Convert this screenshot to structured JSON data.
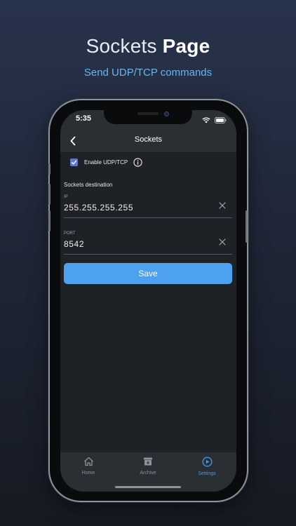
{
  "headline": {
    "regular": "Sockets ",
    "bold": "Page"
  },
  "subline": "Send UDP/TCP commands",
  "status_bar": {
    "time": "5:35"
  },
  "nav": {
    "title": "Sockets"
  },
  "settings": {
    "enable_label": "Enable UDP/TCP",
    "enabled": true,
    "section_title": "Sockets destination",
    "ip": {
      "label": "IP",
      "value": "255.255.255.255"
    },
    "port": {
      "label": "PORT",
      "value": "8542"
    },
    "save_label": "Save"
  },
  "tabs": [
    {
      "label": "Home",
      "icon": "home-icon",
      "active": false
    },
    {
      "label": "Archive",
      "icon": "archive-icon",
      "active": false
    },
    {
      "label": "Settings",
      "icon": "settings-icon",
      "active": true
    }
  ],
  "colors": {
    "accent": "#4ea1ef",
    "checkbox": "#6178c8",
    "subline": "#66b6f2",
    "active_tab": "#3f9de8"
  }
}
